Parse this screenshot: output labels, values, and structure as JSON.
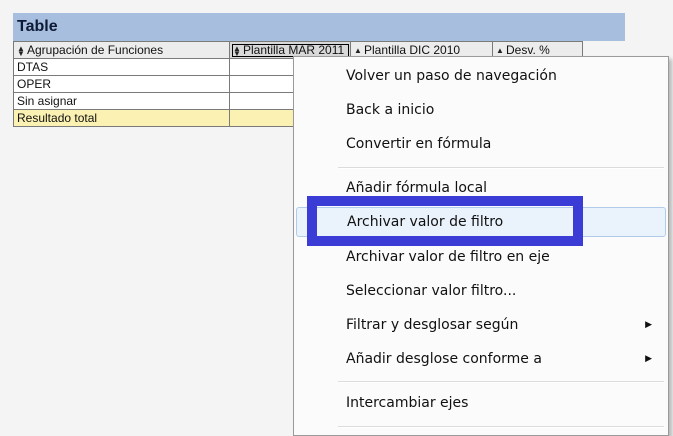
{
  "panel": {
    "title": "Table"
  },
  "table": {
    "headers": [
      "Agrupación de Funciones",
      "Plantilla MAR 2011",
      "Plantilla DIC 2010",
      "Desv. %"
    ],
    "rows": [
      {
        "label": "DTAS"
      },
      {
        "label": "OPER"
      },
      {
        "label": "Sin asignar"
      },
      {
        "label": "Resultado total"
      }
    ]
  },
  "context_menu": {
    "items": [
      {
        "label": "Volver un paso de navegación"
      },
      {
        "label": "Back a inicio"
      },
      {
        "label": "Convertir en fórmula"
      },
      {
        "label": "Añadir fórmula local"
      },
      {
        "label": "Archivar valor de filtro",
        "state": "hovered"
      },
      {
        "label": "Archivar valor de filtro en eje"
      },
      {
        "label": "Seleccionar valor filtro..."
      },
      {
        "label": "Filtrar y desglosar según",
        "submenu": true
      },
      {
        "label": "Añadir desglose conforme a",
        "submenu": true
      },
      {
        "label": "Intercambiar ejes"
      }
    ]
  },
  "annotation": {
    "color": "#3b3bd6"
  }
}
